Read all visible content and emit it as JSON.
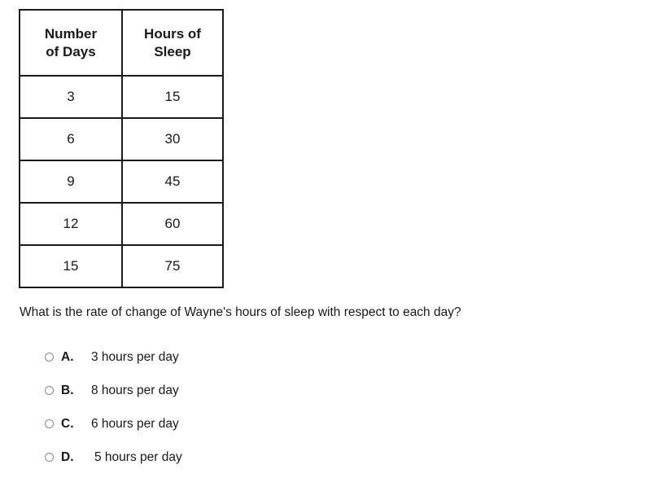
{
  "table": {
    "headers": [
      "Number of Days",
      "Hours of Sleep"
    ],
    "header_lines": [
      [
        "Number",
        "of Days"
      ],
      [
        "Hours of",
        "Sleep"
      ]
    ],
    "rows": [
      [
        "3",
        "15"
      ],
      [
        "6",
        "30"
      ],
      [
        "9",
        "45"
      ],
      [
        "12",
        "60"
      ],
      [
        "15",
        "75"
      ]
    ],
    "border_color": "#1b1b1b"
  },
  "question": {
    "text": "What is the rate of change of Wayne's hours of sleep with respect to each day?"
  },
  "options": [
    {
      "letter": "A.",
      "text": "3 hours per day",
      "radio": "radio-unselected-icon",
      "selected": false
    },
    {
      "letter": "B.",
      "text": "8 hours per day",
      "radio": "radio-unselected-icon",
      "selected": false
    },
    {
      "letter": "C.",
      "text": "6 hours per day",
      "radio": "radio-unselected-icon",
      "selected": false
    },
    {
      "letter": "D.",
      "text": "5 hours per day",
      "radio": "radio-unselected-icon",
      "selected": false
    }
  ],
  "colors": {
    "text": "#1a1a1a",
    "radio_outline": "#8b8b8b",
    "background": "#ffffff"
  }
}
